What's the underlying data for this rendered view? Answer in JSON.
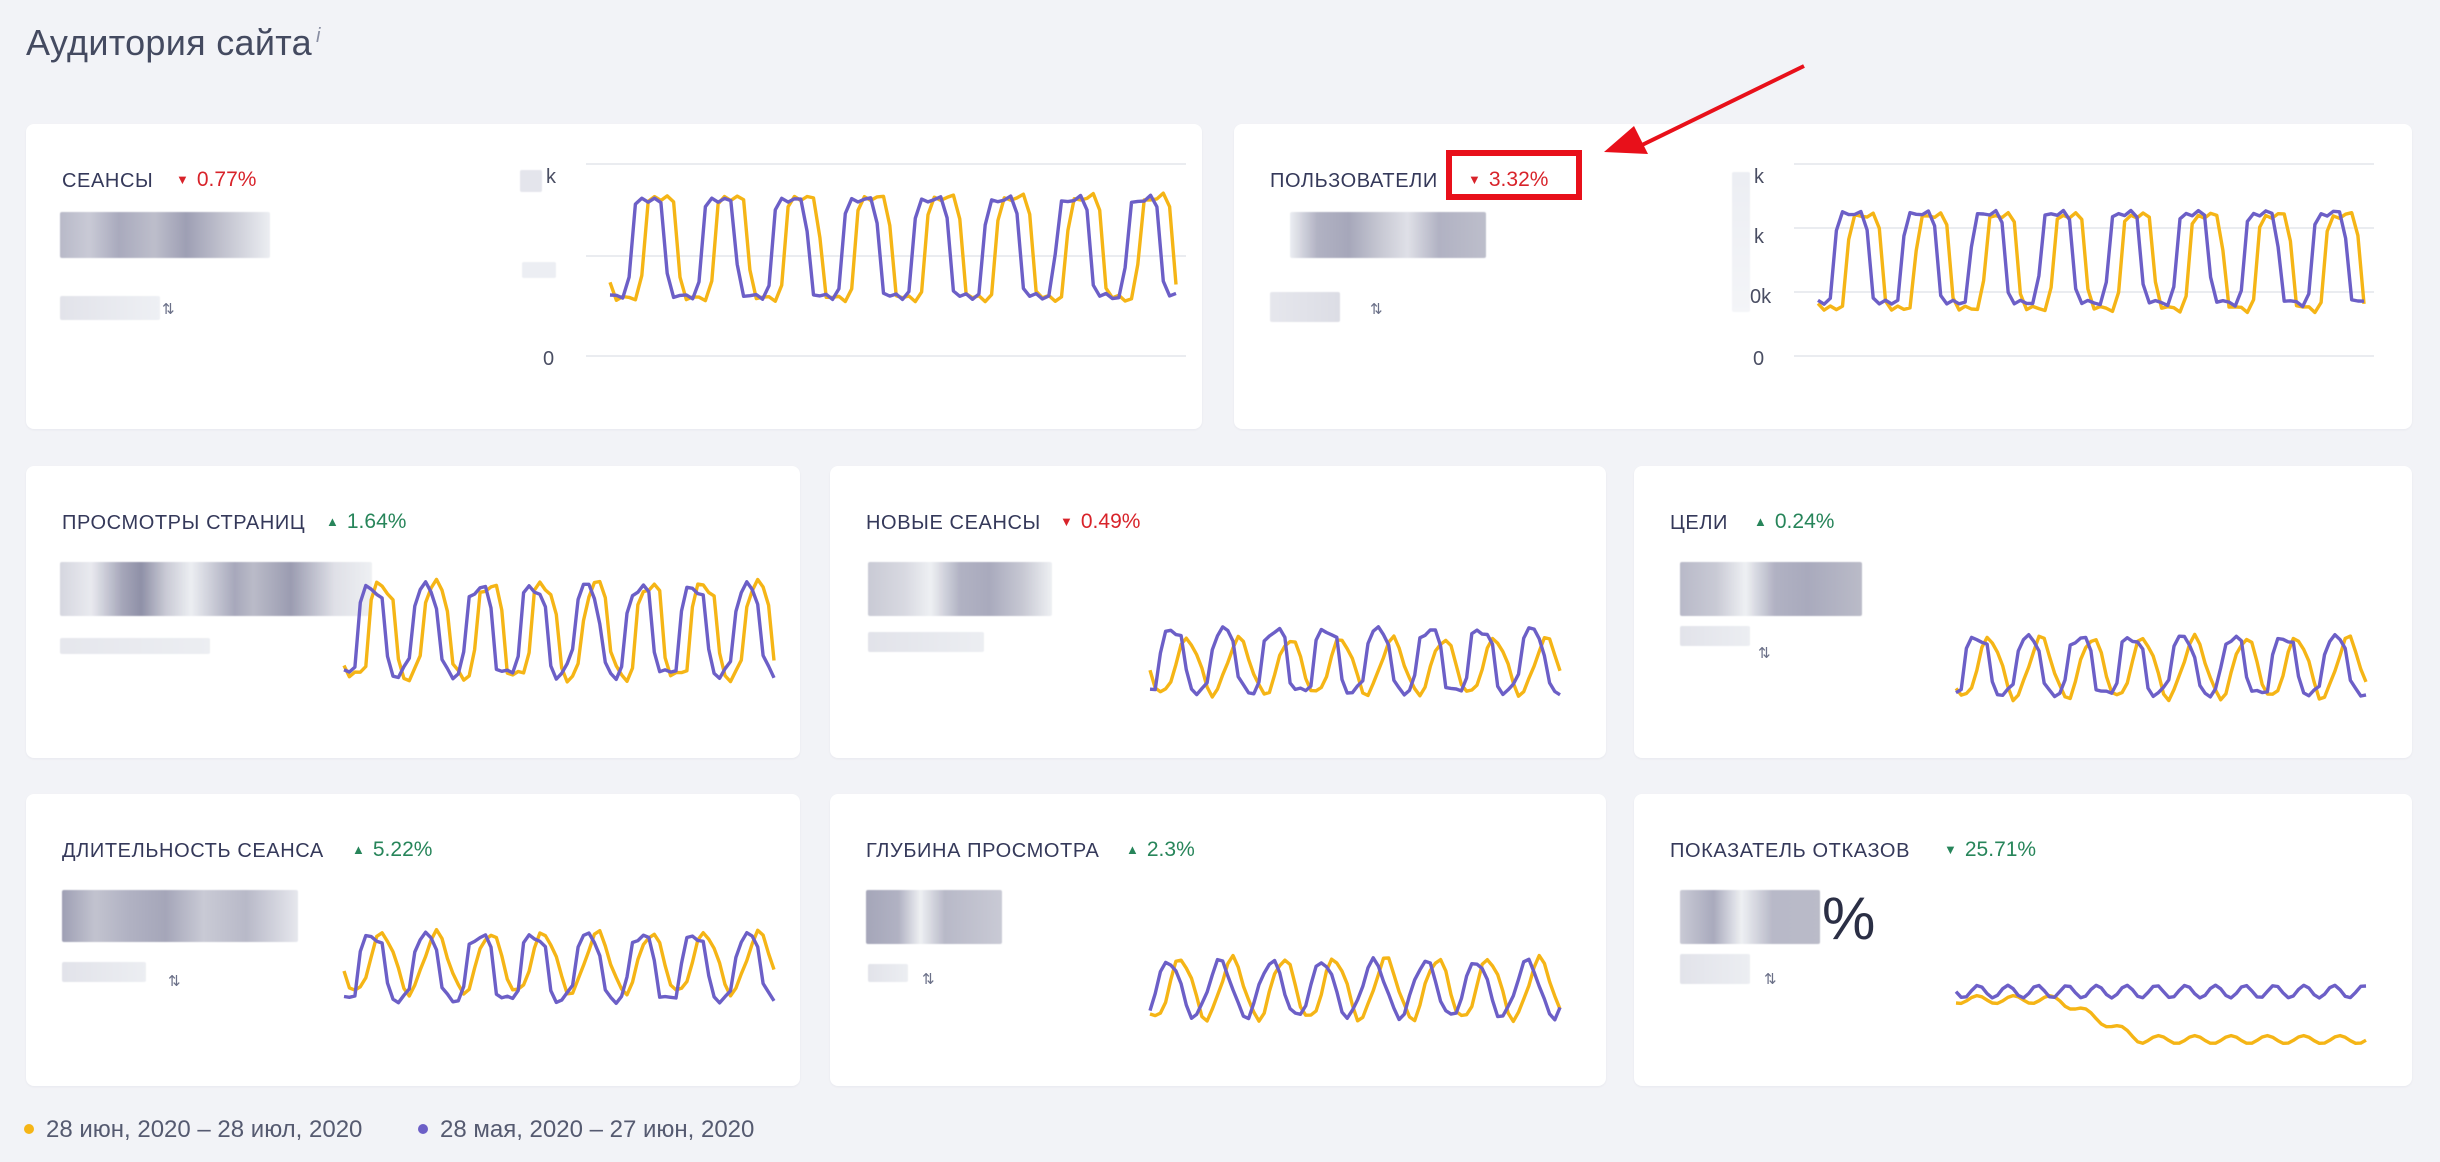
{
  "page": {
    "title": "Аудитория сайта",
    "info_mark": "i"
  },
  "cards": [
    {
      "id": "sessions",
      "label": "СЕАНСЫ",
      "delta": "0.77%",
      "trend": "down",
      "axis": [
        "k",
        "",
        "0"
      ]
    },
    {
      "id": "users",
      "label": "ПОЛЬЗОВАТЕЛИ",
      "delta": "3.32%",
      "trend": "down",
      "axis": [
        "k",
        "k",
        "0k",
        "0"
      ]
    },
    {
      "id": "pageviews",
      "label": "ПРОСМОТРЫ СТРАНИЦ",
      "delta": "1.64%",
      "trend": "up"
    },
    {
      "id": "new-sessions",
      "label": "НОВЫЕ СЕАНСЫ",
      "delta": "0.49%",
      "trend": "down"
    },
    {
      "id": "goals",
      "label": "ЦЕЛИ",
      "delta": "0.24%",
      "trend": "up"
    },
    {
      "id": "session-duration",
      "label": "ДЛИТЕЛЬНОСТЬ СЕАНСА",
      "delta": "5.22%",
      "trend": "up"
    },
    {
      "id": "page-depth",
      "label": "ГЛУБИНА ПРОСМОТРА",
      "delta": "2.3%",
      "trend": "up"
    },
    {
      "id": "bounce-rate",
      "label": "ПОКАЗАТЕЛЬ ОТКАЗОВ",
      "delta": "25.71%",
      "trend": "down",
      "value_suffix": "%"
    }
  ],
  "legend": {
    "current": "28 июн, 2020 – 28 июл, 2020",
    "previous": "28 мая, 2020 – 27 июн, 2020"
  },
  "colors": {
    "current": "#f5b516",
    "previous": "#6c5fc7",
    "down": "#d8232a",
    "up": "#27855a",
    "highlight": "#e8101a"
  },
  "icons": {
    "sort": "sort-arrows-icon",
    "down": "triangle-down-icon",
    "up": "triangle-up-icon"
  }
}
